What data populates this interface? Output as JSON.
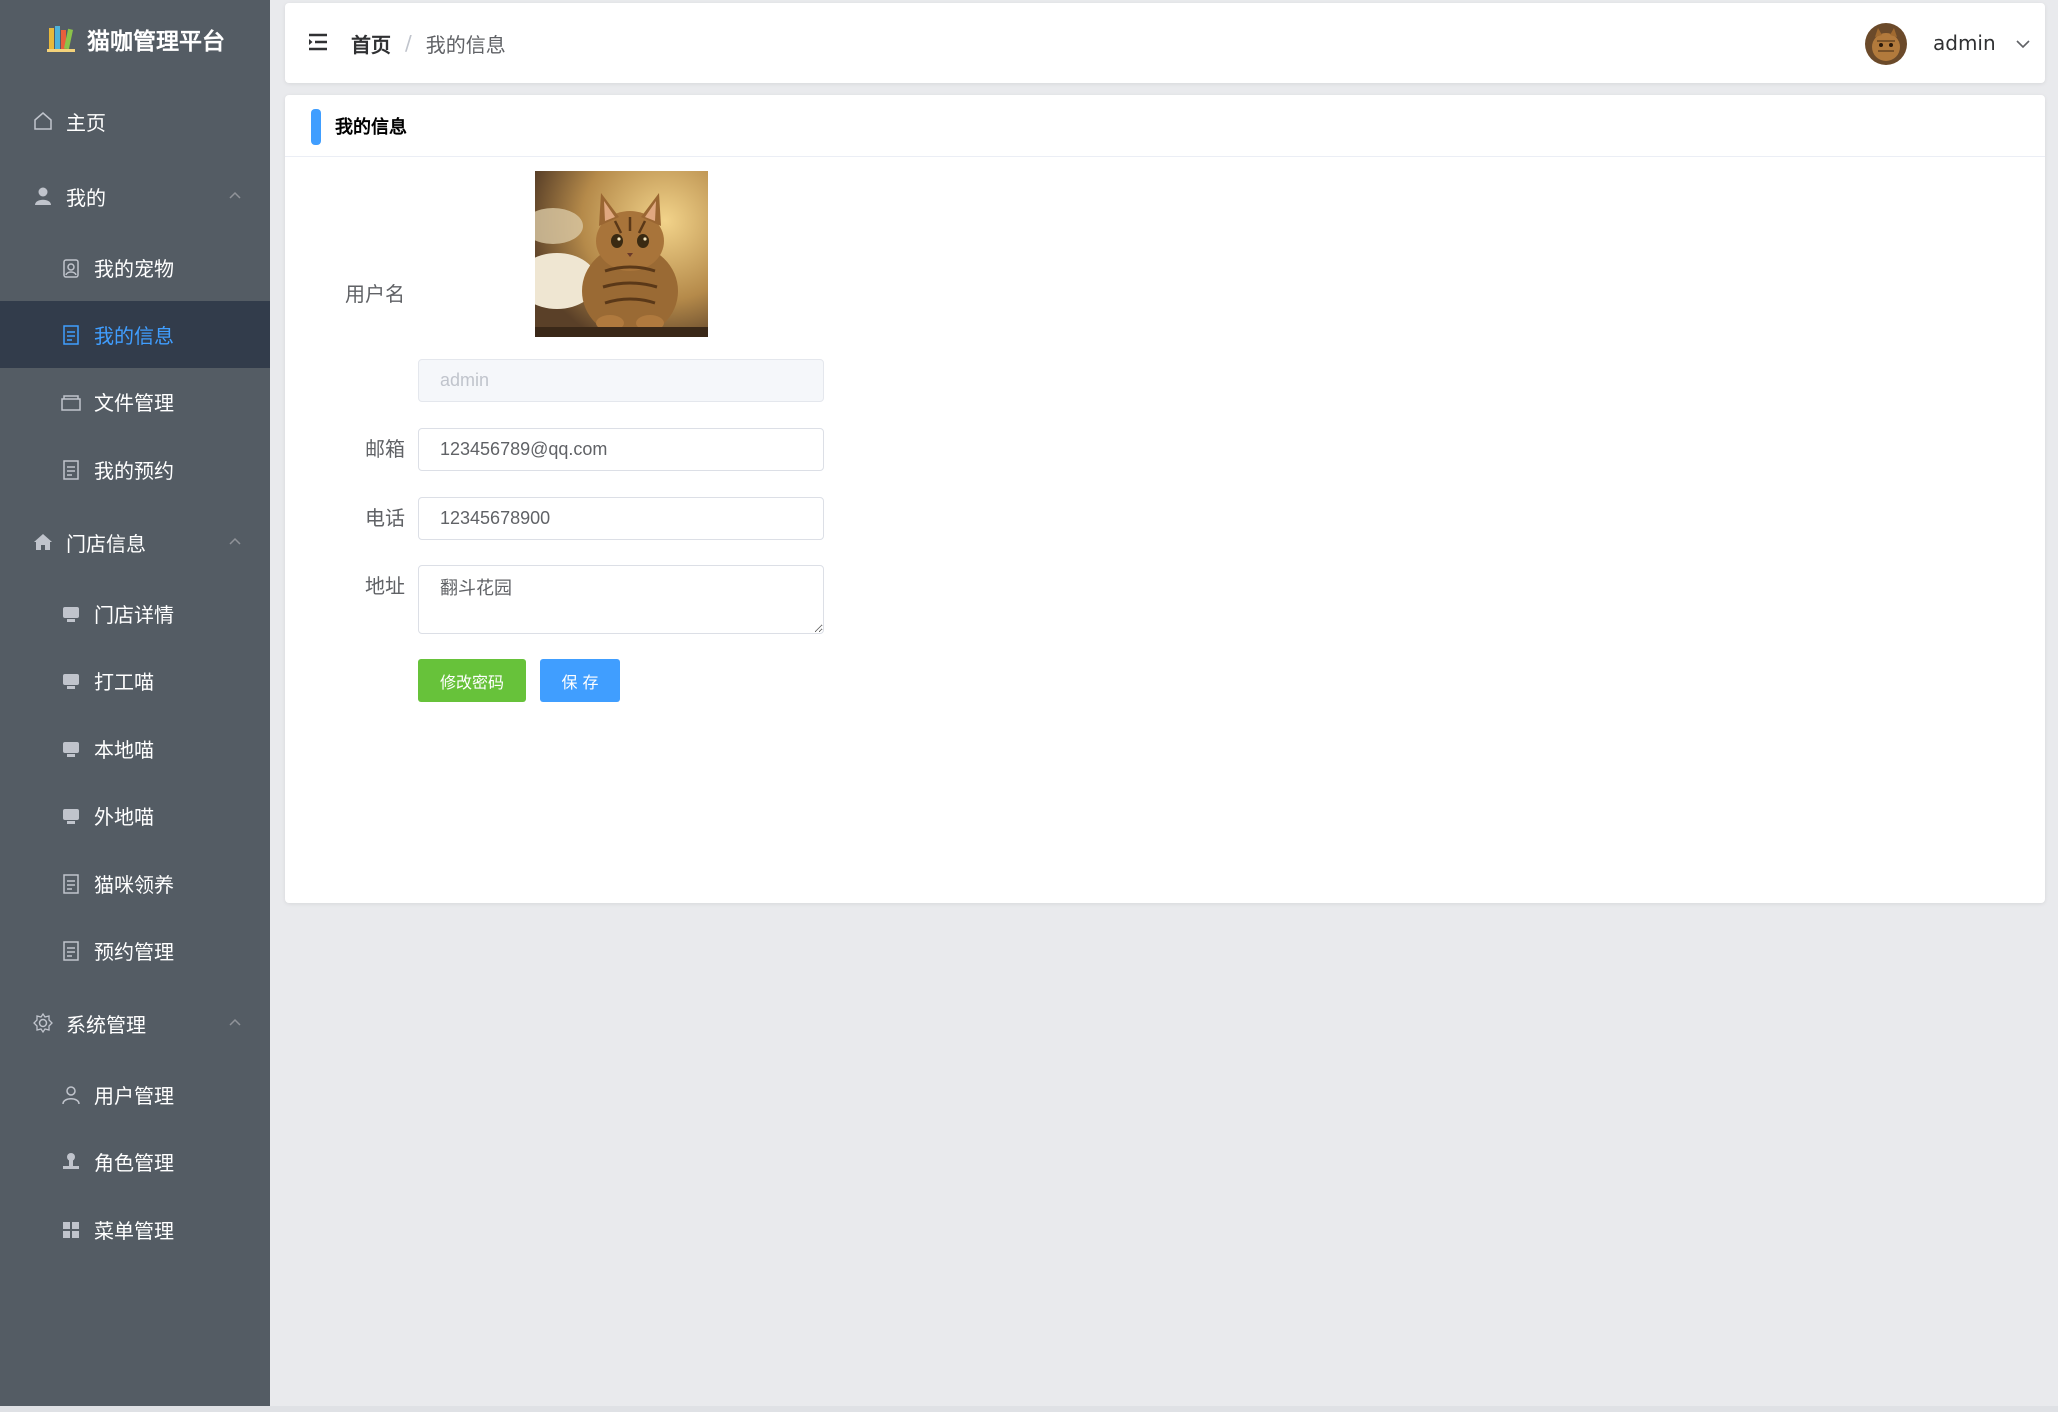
{
  "brand": {
    "title": "猫咖管理平台",
    "logo": "books-logo-icon"
  },
  "sidebar": {
    "items": [
      {
        "label": "主页",
        "icon": "house-icon",
        "level": "top"
      },
      {
        "label": "我的",
        "icon": "user-icon",
        "level": "group",
        "expanded": true
      },
      {
        "label": "我的宠物",
        "icon": "pet-badge-icon",
        "level": "sub"
      },
      {
        "label": "我的信息",
        "icon": "document-icon",
        "level": "sub",
        "active": true
      },
      {
        "label": "文件管理",
        "icon": "folder-icon",
        "level": "sub"
      },
      {
        "label": "我的预约",
        "icon": "document-icon",
        "level": "sub"
      },
      {
        "label": "门店信息",
        "icon": "home-filled-icon",
        "level": "group",
        "expanded": true
      },
      {
        "label": "门店详情",
        "icon": "monitor-icon",
        "level": "sub"
      },
      {
        "label": "打工喵",
        "icon": "monitor-icon",
        "level": "sub"
      },
      {
        "label": "本地喵",
        "icon": "monitor-icon",
        "level": "sub"
      },
      {
        "label": "外地喵",
        "icon": "monitor-icon",
        "level": "sub"
      },
      {
        "label": "猫咪领养",
        "icon": "document-icon",
        "level": "sub"
      },
      {
        "label": "预约管理",
        "icon": "document-icon",
        "level": "sub"
      },
      {
        "label": "系统管理",
        "icon": "gear-icon",
        "level": "group",
        "expanded": true
      },
      {
        "label": "用户管理",
        "icon": "user-outline-icon",
        "level": "sub"
      },
      {
        "label": "角色管理",
        "icon": "stamp-icon",
        "level": "sub"
      },
      {
        "label": "菜单管理",
        "icon": "grid-icon",
        "level": "sub"
      }
    ]
  },
  "header": {
    "breadcrumb_home": "首页",
    "breadcrumb_sep": "/",
    "breadcrumb_current": "我的信息",
    "username": "admin"
  },
  "card": {
    "title": "我的信息"
  },
  "form": {
    "username_label": "用户名",
    "username_value": "admin",
    "email_label": "邮箱",
    "email_value": "123456789@qq.com",
    "phone_label": "电话",
    "phone_value": "12345678900",
    "address_label": "地址",
    "address_value": "翻斗花园",
    "change_password_label": "修改密码",
    "save_label": "保 存"
  },
  "colors": {
    "sidebar_bg": "#545c64",
    "sidebar_active_bg": "#323c4b",
    "accent": "#409eff",
    "success": "#67c23a"
  }
}
